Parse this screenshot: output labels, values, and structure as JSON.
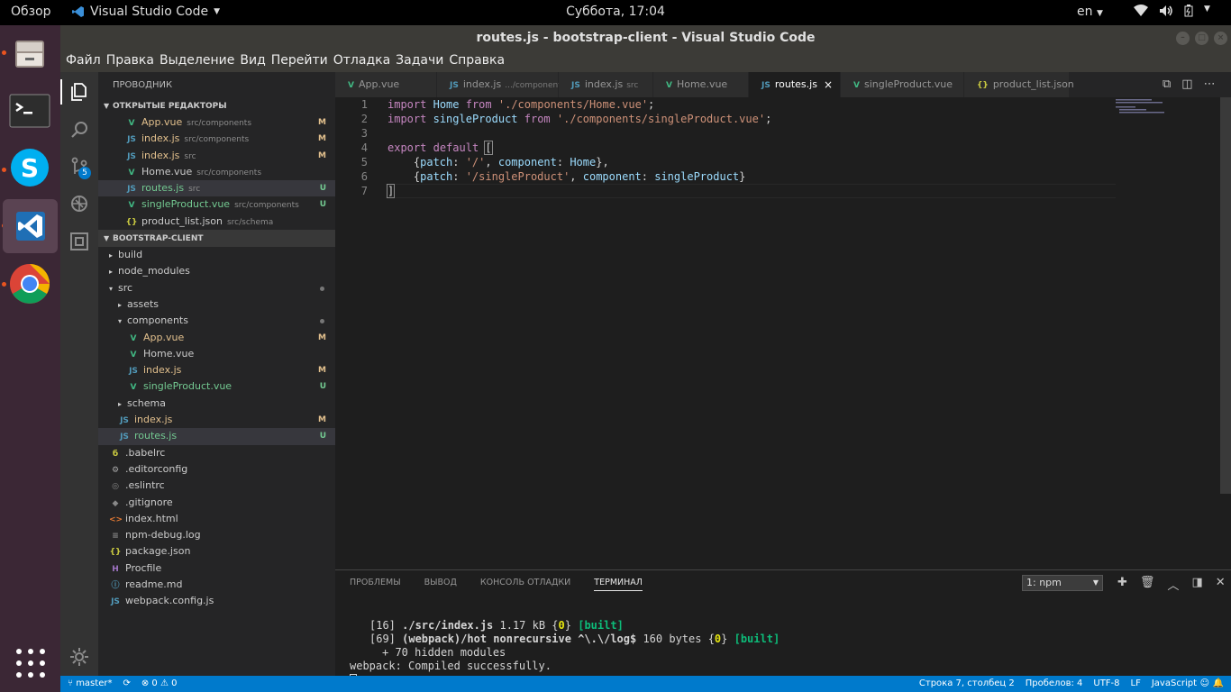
{
  "top_panel": {
    "activities": "Обзор",
    "app_name": "Visual Studio Code",
    "clock": "Суббота, 17:04",
    "language": "en"
  },
  "window": {
    "title": "routes.js - bootstrap-client - Visual Studio Code"
  },
  "menu": [
    "Файл",
    "Правка",
    "Выделение",
    "Вид",
    "Перейти",
    "Отладка",
    "Задачи",
    "Справка"
  ],
  "activity_bar": {
    "scm_badge": "5"
  },
  "explorer": {
    "title": "ПРОВОДНИК",
    "open_editors_header": "ОТКРЫТЫЕ РЕДАКТОРЫ",
    "open_editors": [
      {
        "name": "App.vue",
        "desc": "src/components",
        "status": "M",
        "icon": "vue"
      },
      {
        "name": "index.js",
        "desc": "src/components",
        "status": "M",
        "icon": "js"
      },
      {
        "name": "index.js",
        "desc": "src",
        "status": "M",
        "icon": "js"
      },
      {
        "name": "Home.vue",
        "desc": "src/components",
        "status": "",
        "icon": "vue"
      },
      {
        "name": "routes.js",
        "desc": "src",
        "status": "U",
        "icon": "js"
      },
      {
        "name": "singleProduct.vue",
        "desc": "src/components",
        "status": "U",
        "icon": "vue"
      },
      {
        "name": "product_list.json",
        "desc": "src/schema",
        "status": "",
        "icon": "json"
      }
    ],
    "project_header": "BOOTSTRAP-CLIENT",
    "tree": [
      {
        "name": "build",
        "kind": "folder",
        "status": ""
      },
      {
        "name": "node_modules",
        "kind": "folder",
        "status": ""
      },
      {
        "name": "src",
        "kind": "folder-open",
        "status": "dot"
      },
      {
        "name": "assets",
        "kind": "folder",
        "status": ""
      },
      {
        "name": "components",
        "kind": "folder-open",
        "status": "dot"
      },
      {
        "name": "App.vue",
        "kind": "vue",
        "status": "M"
      },
      {
        "name": "Home.vue",
        "kind": "vue",
        "status": ""
      },
      {
        "name": "index.js",
        "kind": "js",
        "status": "M"
      },
      {
        "name": "singleProduct.vue",
        "kind": "vue",
        "status": "U"
      },
      {
        "name": "schema",
        "kind": "folder",
        "status": ""
      },
      {
        "name": "index.js",
        "kind": "js",
        "status": "M"
      },
      {
        "name": "routes.js",
        "kind": "js",
        "status": "U"
      },
      {
        "name": ".babelrc",
        "kind": "babel",
        "status": ""
      },
      {
        "name": ".editorconfig",
        "kind": "gear",
        "status": ""
      },
      {
        "name": ".eslintrc",
        "kind": "eslint",
        "status": ""
      },
      {
        "name": ".gitignore",
        "kind": "git",
        "status": ""
      },
      {
        "name": "index.html",
        "kind": "html",
        "status": ""
      },
      {
        "name": "npm-debug.log",
        "kind": "log",
        "status": ""
      },
      {
        "name": "package.json",
        "kind": "json",
        "status": ""
      },
      {
        "name": "Procfile",
        "kind": "heroku",
        "status": ""
      },
      {
        "name": "readme.md",
        "kind": "info",
        "status": ""
      },
      {
        "name": "webpack.config.js",
        "kind": "js",
        "status": ""
      }
    ]
  },
  "tabs": [
    {
      "name": "App.vue",
      "desc": "",
      "icon": "vue"
    },
    {
      "name": "index.js",
      "desc": ".../components",
      "icon": "js"
    },
    {
      "name": "index.js",
      "desc": "src",
      "icon": "js"
    },
    {
      "name": "Home.vue",
      "desc": "",
      "icon": "vue"
    },
    {
      "name": "routes.js",
      "desc": "",
      "icon": "js"
    },
    {
      "name": "singleProduct.vue",
      "desc": "",
      "icon": "vue"
    },
    {
      "name": "product_list.json",
      "desc": "",
      "icon": "json"
    }
  ],
  "editor": {
    "line_numbers": [
      "1",
      "2",
      "3",
      "4",
      "5",
      "6",
      "7"
    ]
  },
  "panel": {
    "tabs": [
      "ПРОБЛЕМЫ",
      "ВЫВОД",
      "КОНСОЛЬ ОТЛАДКИ",
      "ТЕРМИНАЛ"
    ],
    "terminal_select": "1: npm",
    "terminal_lines": [
      "[16] ./src/index.js 1.17 kB {0} [built]",
      "[69] (webpack)/hot nonrecursive ^\\.\\/log$ 160 bytes {0} [built]",
      "+ 70 hidden modules",
      "webpack: Compiled successfully."
    ]
  },
  "status": {
    "branch": "master*",
    "errors": "0",
    "warnings": "0",
    "position": "Строка 7, столбец 2",
    "spaces": "Пробелов: 4",
    "encoding": "UTF-8",
    "eol": "LF",
    "language": "JavaScript"
  },
  "colors": {
    "status_bar": "#007acc",
    "dock": "#3b2735",
    "modified": "#e2c08d",
    "untracked": "#73c991"
  }
}
